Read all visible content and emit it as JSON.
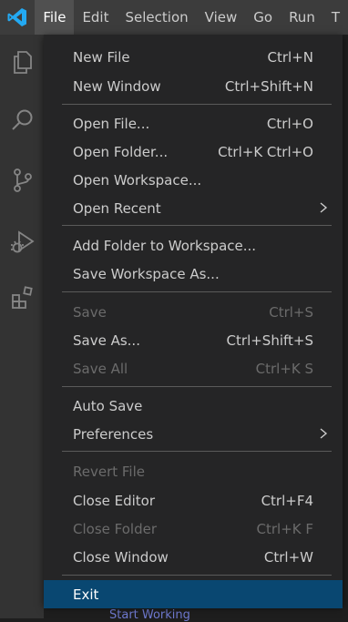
{
  "menubar": {
    "items": [
      {
        "label": "File"
      },
      {
        "label": "Edit"
      },
      {
        "label": "Selection"
      },
      {
        "label": "View"
      },
      {
        "label": "Go"
      },
      {
        "label": "Run"
      },
      {
        "label": "T"
      }
    ]
  },
  "activity_bar": {
    "icons": [
      "explorer-icon",
      "search-icon",
      "source-control-icon",
      "run-debug-icon",
      "extensions-icon"
    ]
  },
  "file_menu": {
    "items": [
      {
        "label": "New File",
        "shortcut": "Ctrl+N"
      },
      {
        "label": "New Window",
        "shortcut": "Ctrl+Shift+N"
      },
      {
        "label": "Open File...",
        "shortcut": "Ctrl+O"
      },
      {
        "label": "Open Folder...",
        "shortcut": "Ctrl+K Ctrl+O"
      },
      {
        "label": "Open Workspace...",
        "shortcut": ""
      },
      {
        "label": "Open Recent",
        "shortcut": "",
        "submenu": true
      },
      {
        "label": "Add Folder to Workspace...",
        "shortcut": ""
      },
      {
        "label": "Save Workspace As...",
        "shortcut": ""
      },
      {
        "label": "Save",
        "shortcut": "Ctrl+S",
        "disabled": true
      },
      {
        "label": "Save As...",
        "shortcut": "Ctrl+Shift+S"
      },
      {
        "label": "Save All",
        "shortcut": "Ctrl+K S",
        "disabled": true
      },
      {
        "label": "Auto Save",
        "shortcut": ""
      },
      {
        "label": "Preferences",
        "shortcut": "",
        "submenu": true
      },
      {
        "label": "Revert File",
        "shortcut": "",
        "disabled": true
      },
      {
        "label": "Close Editor",
        "shortcut": "Ctrl+F4"
      },
      {
        "label": "Close Folder",
        "shortcut": "Ctrl+K F",
        "disabled": true
      },
      {
        "label": "Close Window",
        "shortcut": "Ctrl+W"
      },
      {
        "label": "Exit",
        "shortcut": "",
        "selected": true
      }
    ]
  },
  "editor": {
    "peek_text": "Start Working"
  },
  "colors": {
    "accent_logo": "#23a9f2",
    "menu_bg": "#252526",
    "selection_bg": "#094771",
    "titlebar_bg": "#3c3c3c"
  }
}
